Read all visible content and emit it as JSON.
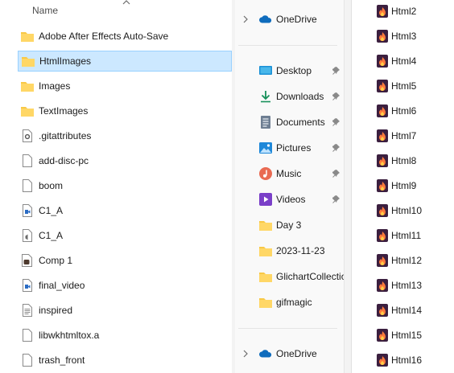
{
  "left_pane": {
    "column_header": "Name",
    "rows": [
      {
        "label": "Adobe After Effects Auto-Save",
        "icon": "folder-icon"
      },
      {
        "label": "HtmlImages",
        "icon": "folder-icon",
        "selected": true
      },
      {
        "label": "Images",
        "icon": "folder-icon"
      },
      {
        "label": "TextImages",
        "icon": "folder-icon"
      },
      {
        "label": ".gitattributes",
        "icon": "settings-file-icon"
      },
      {
        "label": "add-disc-pc",
        "icon": "file-icon"
      },
      {
        "label": "boom",
        "icon": "file-icon"
      },
      {
        "label": "C1_A",
        "icon": "video-file-icon"
      },
      {
        "label": "C1_A",
        "icon": "audio-file-icon"
      },
      {
        "label": "Comp 1",
        "icon": "media-file-icon"
      },
      {
        "label": "final_video",
        "icon": "video-file-icon"
      },
      {
        "label": "inspired",
        "icon": "text-file-icon"
      },
      {
        "label": "libwkhtmltox.a",
        "icon": "file-icon"
      },
      {
        "label": "trash_front",
        "icon": "file-icon"
      }
    ]
  },
  "nav_pane": {
    "onedrive_top": "OneDrive",
    "quick_access": [
      {
        "label": "Desktop",
        "icon": "desktop-icon",
        "pinned": true
      },
      {
        "label": "Downloads",
        "icon": "download-icon",
        "pinned": true
      },
      {
        "label": "Documents",
        "icon": "documents-icon",
        "pinned": true
      },
      {
        "label": "Pictures",
        "icon": "pictures-icon",
        "pinned": true
      },
      {
        "label": "Music",
        "icon": "music-icon",
        "pinned": true
      },
      {
        "label": "Videos",
        "icon": "videos-icon",
        "pinned": true
      },
      {
        "label": "Day 3",
        "icon": "folder-icon",
        "pinned": false
      },
      {
        "label": "2023-11-23",
        "icon": "folder-icon",
        "pinned": false
      },
      {
        "label": "GlichartCollectio",
        "icon": "folder-icon",
        "pinned": false
      },
      {
        "label": "gifmagic",
        "icon": "folder-icon",
        "pinned": false
      }
    ],
    "onedrive_bottom": "OneDrive"
  },
  "right_pane": {
    "files": [
      "Html2",
      "Html3",
      "Html4",
      "Html5",
      "Html6",
      "Html7",
      "Html8",
      "Html9",
      "Html10",
      "Html11",
      "Html12",
      "Html13",
      "Html14",
      "Html15",
      "Html16"
    ]
  },
  "colors": {
    "folder": "#f8c846",
    "selection": "#cce8ff",
    "onedrive": "#0f6cbd",
    "html_icon": "#3b1f3f"
  }
}
